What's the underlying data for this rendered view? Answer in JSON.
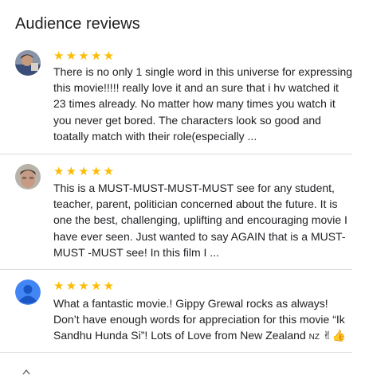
{
  "section": {
    "title": "Audience reviews"
  },
  "reviews": [
    {
      "stars": "★★★★★",
      "rating": 5,
      "text": "There is no only 1 single word in this universe for expressing this movie!!!!! really love it and an sure that i hv watched it 23 times already. No matter how many times you watch it you never get bored. The characters look so good and toatally match with their role(especially ..."
    },
    {
      "stars": "★★★★★",
      "rating": 5,
      "text": "This is a MUST-MUST-MUST-MUST see for any student, teacher, parent, politician concerned about the future. It is one the best, challenging, uplifting and encouraging movie I have ever seen. Just wanted to say AGAIN that is a MUST-MUST -MUST see! In this film I ..."
    },
    {
      "stars": "★★★★★",
      "rating": 5,
      "text": "What a fantastic movie.! Gippy Grewal rocks as always! Don’t have enough words for appreciation for this movie “Ik Sandhu Hunda Si”! Lots of Love from New Zealand",
      "flag": "NZ",
      "emoji": "✌👍"
    }
  ],
  "colors": {
    "star": "#fbbc04",
    "divider": "#dadce0",
    "default_avatar": "#4285f4"
  }
}
